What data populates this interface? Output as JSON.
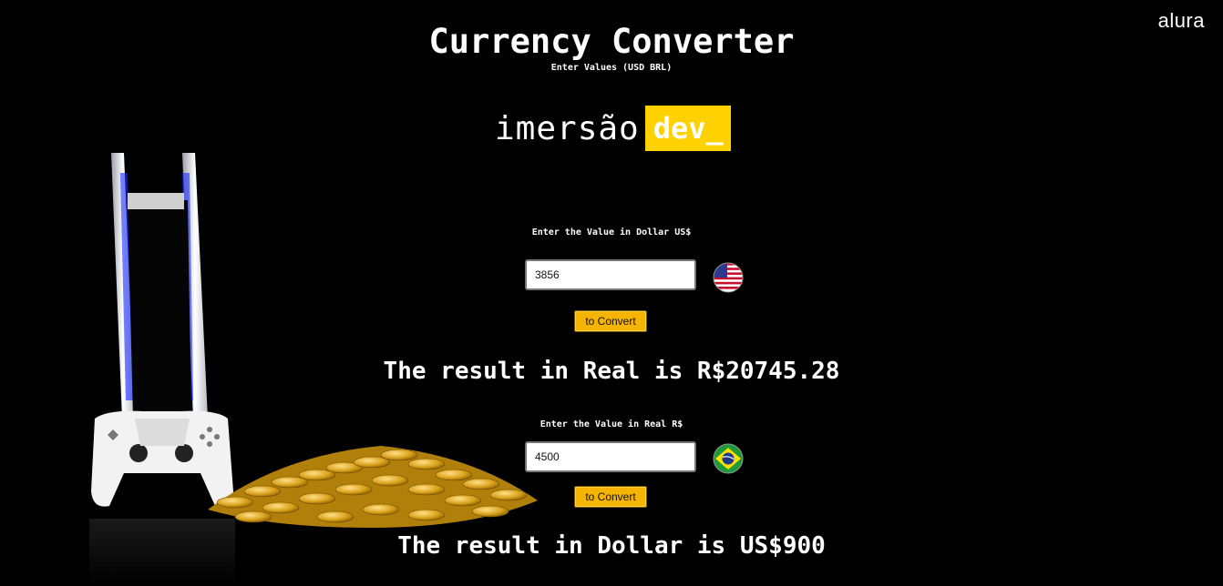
{
  "brand": "alura",
  "header": {
    "title": "Currency Converter",
    "subtitle": "Enter Values (USD BRL)"
  },
  "logo": {
    "word": "imersão",
    "chip": "dev_"
  },
  "usd_section": {
    "label": "Enter the Value in Dollar US$",
    "value": "3856",
    "button": "to Convert",
    "flag": "usa-flag-icon",
    "result": "The result in Real is R$20745.28"
  },
  "brl_section": {
    "label": "Enter the Value in Real R$",
    "value": "4500",
    "button": "to Convert",
    "flag": "brazil-flag-icon",
    "result": "The result in Dollar is US$900"
  },
  "colors": {
    "background": "#000000",
    "accent": "#ffd100",
    "button": "#f5b400",
    "text": "#ffffff"
  }
}
